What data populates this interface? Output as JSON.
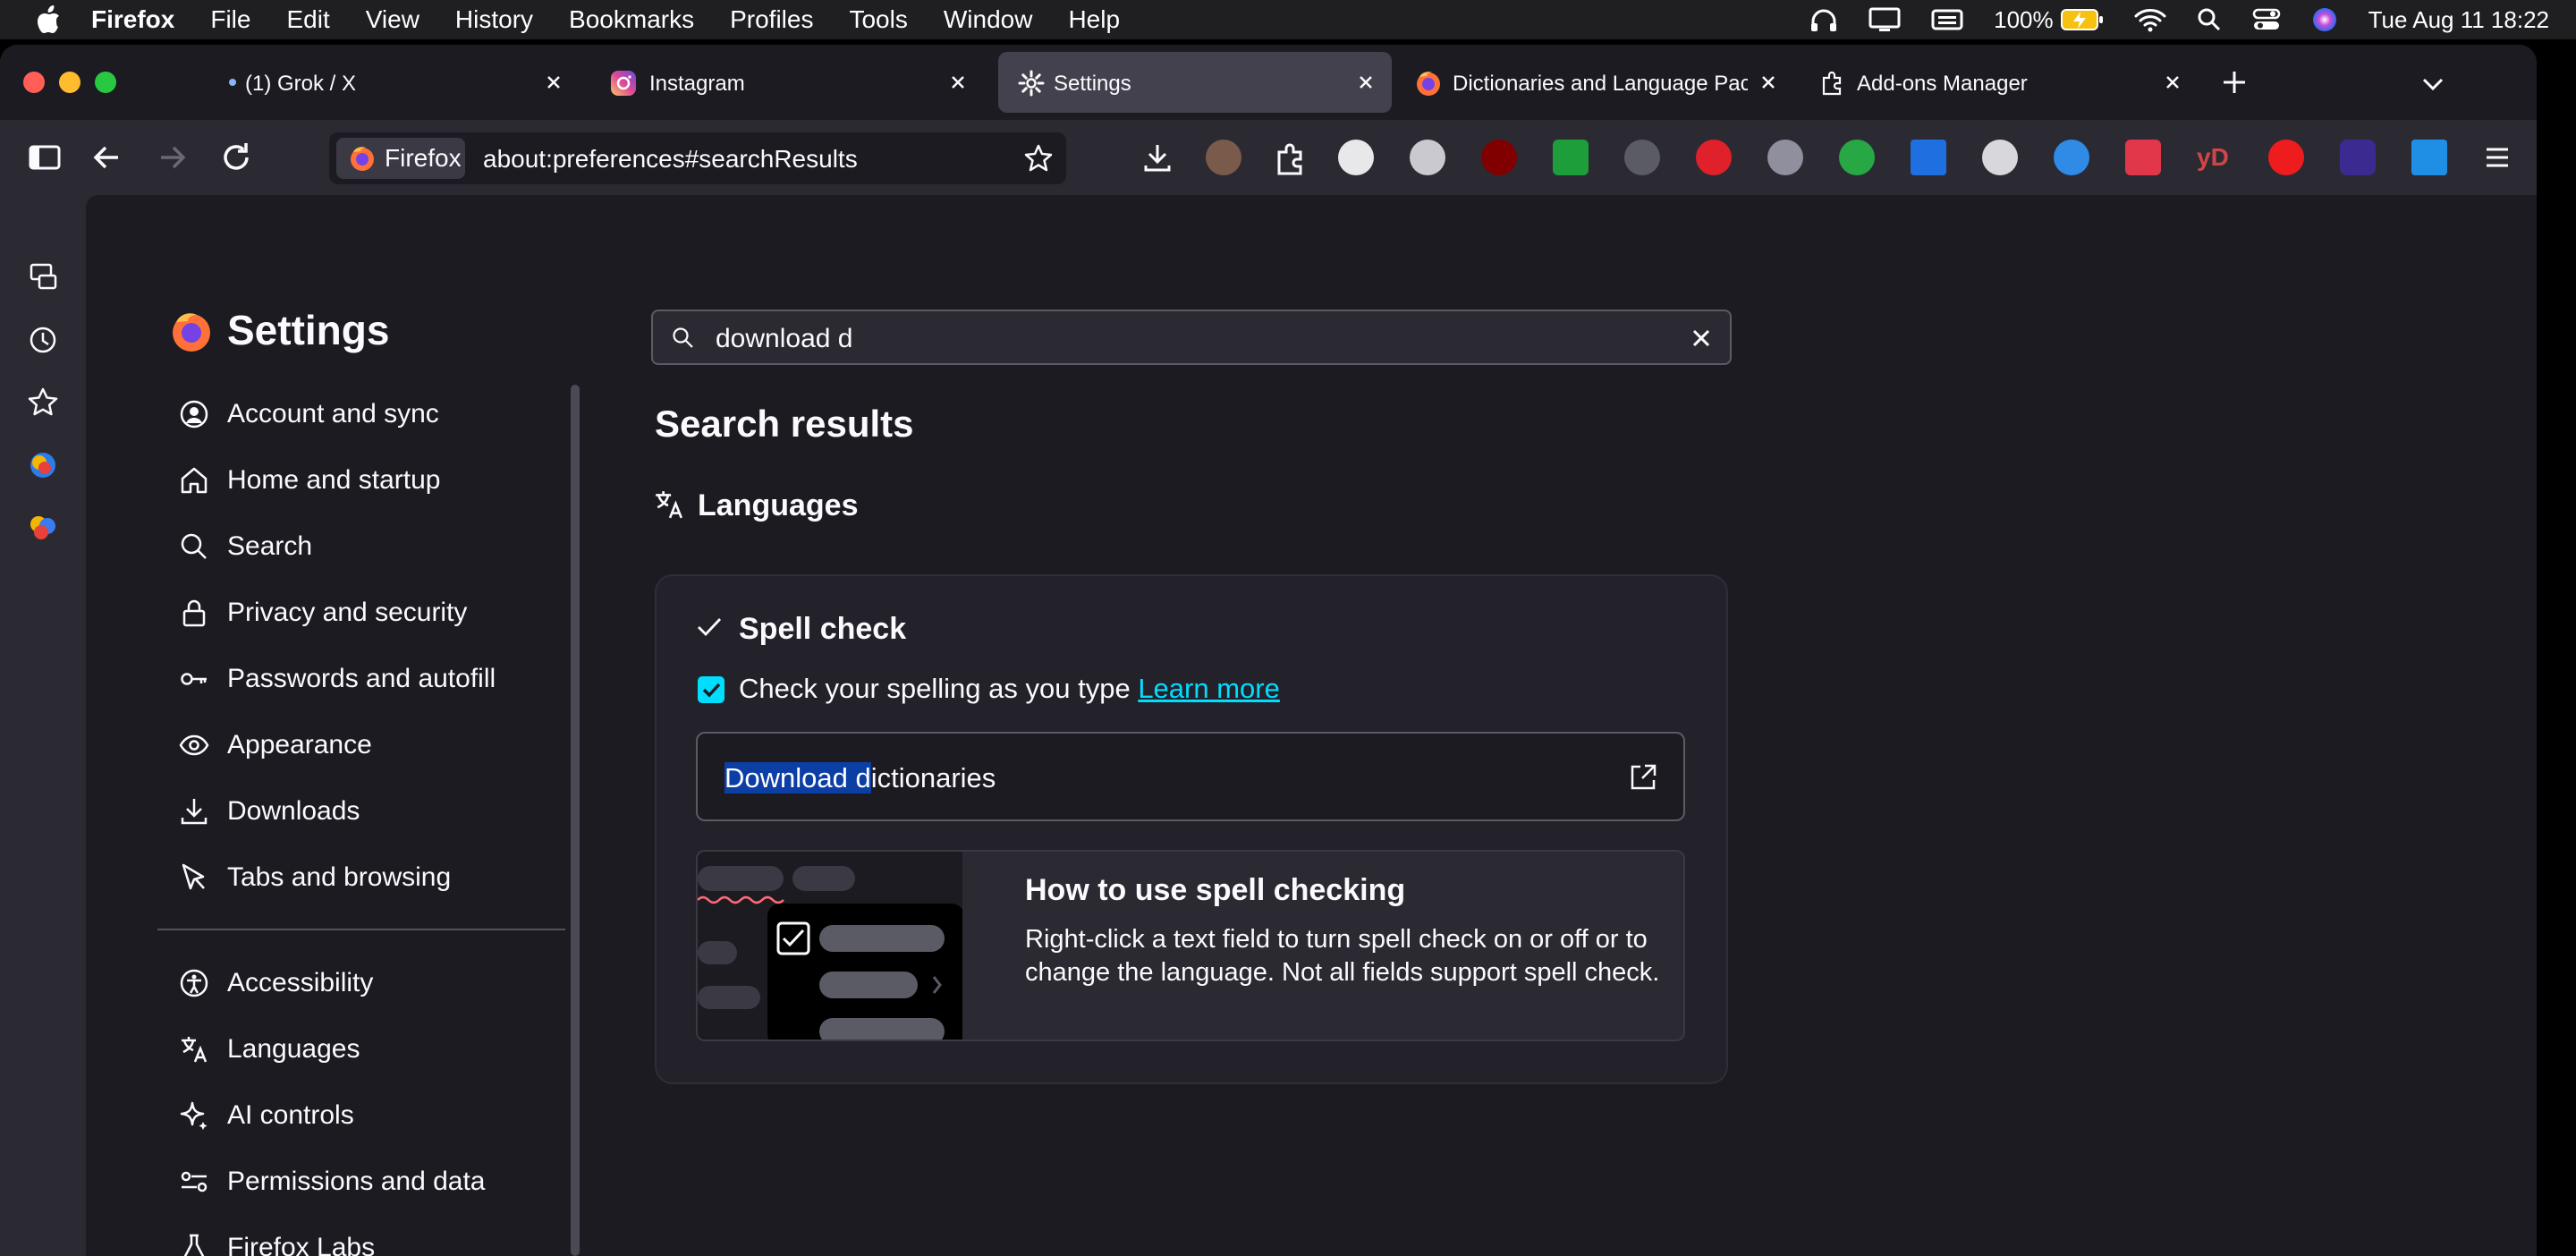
{
  "menubar": {
    "app": "Firefox",
    "items": [
      "File",
      "Edit",
      "View",
      "History",
      "Bookmarks",
      "Profiles",
      "Tools",
      "Window",
      "Help"
    ],
    "battery": "100%",
    "datetime": "Tue Aug 11  18:22"
  },
  "tabs": [
    {
      "label": "(1) Grok / X",
      "icon": "x-icon"
    },
    {
      "label": "Instagram",
      "icon": "instagram-icon"
    },
    {
      "label": "Settings",
      "icon": "gear-icon",
      "active": true
    },
    {
      "label": "Dictionaries and Language Packs",
      "icon": "firefox-icon"
    },
    {
      "label": "Add-ons Manager",
      "icon": "puzzle-icon"
    }
  ],
  "urlbar": {
    "identity": "Firefox",
    "url": "about:preferences#searchResults"
  },
  "settings": {
    "title": "Settings",
    "categories": [
      {
        "label": "Account and sync",
        "icon": "account-icon"
      },
      {
        "label": "Home and startup",
        "icon": "home-icon"
      },
      {
        "label": "Search",
        "icon": "search-icon"
      },
      {
        "label": "Privacy and security",
        "icon": "lock-icon"
      },
      {
        "label": "Passwords and autofill",
        "icon": "key-icon"
      },
      {
        "label": "Appearance",
        "icon": "eye-icon"
      },
      {
        "label": "Downloads",
        "icon": "download-icon"
      },
      {
        "label": "Tabs and browsing",
        "icon": "cursor-icon"
      },
      {
        "label": "Accessibility",
        "icon": "accessibility-icon"
      },
      {
        "label": "Languages",
        "icon": "translate-icon"
      },
      {
        "label": "AI controls",
        "icon": "sparkle-icon"
      },
      {
        "label": "Permissions and data",
        "icon": "permissions-icon"
      },
      {
        "label": "Firefox Labs",
        "icon": "flask-icon"
      }
    ]
  },
  "search": {
    "value": "download d"
  },
  "results": {
    "title": "Search results",
    "section": "Languages",
    "card": {
      "title": "Spell check",
      "checkbox_label": "Check your spelling as you type",
      "checkbox_checked": true,
      "learn_more": "Learn more",
      "download_highlight": "Download d",
      "download_rest": "ictionaries",
      "howto_title": "How to use spell checking",
      "howto_body": "Right-click a text field to turn spell check on or off or to change the language. Not all fields support spell check."
    }
  },
  "colors": {
    "accent": "#00ddff",
    "page_bg": "#1c1b22",
    "chrome_bg": "#2b2a33",
    "highlight": "#0b3fa6"
  }
}
